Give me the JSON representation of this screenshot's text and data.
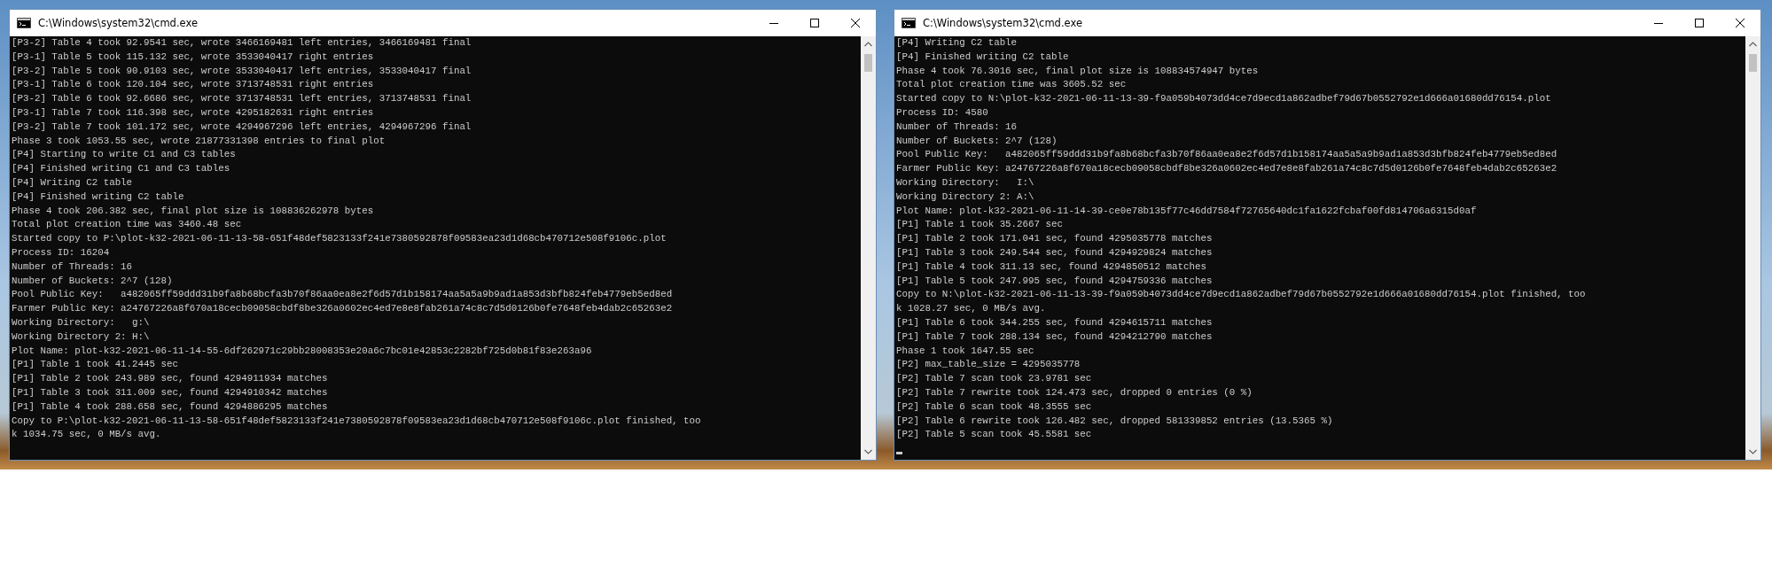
{
  "windows": [
    {
      "title": "C:\\Windows\\system32\\cmd.exe",
      "cursor": false,
      "lines": [
        "[P3-2] Table 4 took 92.9541 sec, wrote 3466169481 left entries, 3466169481 final",
        "[P3-1] Table 5 took 115.132 sec, wrote 3533040417 right entries",
        "[P3-2] Table 5 took 90.9103 sec, wrote 3533040417 left entries, 3533040417 final",
        "[P3-1] Table 6 took 120.104 sec, wrote 3713748531 right entries",
        "[P3-2] Table 6 took 92.6686 sec, wrote 3713748531 left entries, 3713748531 final",
        "[P3-1] Table 7 took 116.398 sec, wrote 4295182631 right entries",
        "[P3-2] Table 7 took 101.172 sec, wrote 4294967296 left entries, 4294967296 final",
        "Phase 3 took 1053.55 sec, wrote 21877331398 entries to final plot",
        "[P4] Starting to write C1 and C3 tables",
        "[P4] Finished writing C1 and C3 tables",
        "[P4] Writing C2 table",
        "[P4] Finished writing C2 table",
        "Phase 4 took 206.382 sec, final plot size is 108836262978 bytes",
        "Total plot creation time was 3460.48 sec",
        "Started copy to P:\\plot-k32-2021-06-11-13-58-651f48def5823133f241e7380592878f09583ea23d1d68cb470712e508f9106c.plot",
        "Process ID: 16204",
        "Number of Threads: 16",
        "Number of Buckets: 2^7 (128)",
        "Pool Public Key:   a482065ff59ddd31b9fa8b68bcfa3b70f86aa0ea8e2f6d57d1b158174aa5a5a9b9ad1a853d3bfb824feb4779eb5ed8ed",
        "Farmer Public Key: a24767226a8f670a18cecb09058cbdf8be326a0602ec4ed7e8e8fab261a74c8c7d5d0126b0fe7648feb4dab2c65263e2",
        "Working Directory:   g:\\",
        "Working Directory 2: H:\\",
        "Plot Name: plot-k32-2021-06-11-14-55-6df262971c29bb28008353e20a6c7bc01e42853c2282bf725d0b81f83e263a96",
        "[P1] Table 1 took 41.2445 sec",
        "[P1] Table 2 took 243.989 sec, found 4294911934 matches",
        "[P1] Table 3 took 311.009 sec, found 4294910342 matches",
        "[P1] Table 4 took 288.658 sec, found 4294886295 matches",
        "Copy to P:\\plot-k32-2021-06-11-13-58-651f48def5823133f241e7380592878f09583ea23d1d68cb470712e508f9106c.plot finished, too",
        "k 1034.75 sec, 0 MB/s avg."
      ]
    },
    {
      "title": "C:\\Windows\\system32\\cmd.exe",
      "cursor": true,
      "lines": [
        "[P4] Writing C2 table",
        "[P4] Finished writing C2 table",
        "Phase 4 took 76.3016 sec, final plot size is 108834574947 bytes",
        "Total plot creation time was 3605.52 sec",
        "Started copy to N:\\plot-k32-2021-06-11-13-39-f9a059b4073dd4ce7d9ecd1a862adbef79d67b0552792e1d666a01680dd76154.plot",
        "Process ID: 4580",
        "Number of Threads: 16",
        "Number of Buckets: 2^7 (128)",
        "Pool Public Key:   a482065ff59ddd31b9fa8b68bcfa3b70f86aa0ea8e2f6d57d1b158174aa5a5a9b9ad1a853d3bfb824feb4779eb5ed8ed",
        "Farmer Public Key: a24767226a8f670a18cecb09058cbdf8be326a0602ec4ed7e8e8fab261a74c8c7d5d0126b0fe7648feb4dab2c65263e2",
        "Working Directory:   I:\\",
        "Working Directory 2: A:\\",
        "Plot Name: plot-k32-2021-06-11-14-39-ce0e78b135f77c46dd7584f72765640dc1fa1622fcbaf00fd814706a6315d0af",
        "[P1] Table 1 took 35.2667 sec",
        "[P1] Table 2 took 171.041 sec, found 4295035778 matches",
        "[P1] Table 3 took 249.544 sec, found 4294929824 matches",
        "[P1] Table 4 took 311.13 sec, found 4294850512 matches",
        "[P1] Table 5 took 247.995 sec, found 4294759336 matches",
        "Copy to N:\\plot-k32-2021-06-11-13-39-f9a059b4073dd4ce7d9ecd1a862adbef79d67b0552792e1d666a01680dd76154.plot finished, too",
        "k 1028.27 sec, 0 MB/s avg.",
        "[P1] Table 6 took 344.255 sec, found 4294615711 matches",
        "[P1] Table 7 took 288.134 sec, found 4294212790 matches",
        "Phase 1 took 1647.55 sec",
        "[P2] max_table_size = 4295035778",
        "[P2] Table 7 scan took 23.9781 sec",
        "[P2] Table 7 rewrite took 124.473 sec, dropped 0 entries (0 %)",
        "[P2] Table 6 scan took 48.3555 sec",
        "[P2] Table 6 rewrite took 126.482 sec, dropped 581339852 entries (13.5365 %)",
        "[P2] Table 5 scan took 45.5581 sec"
      ]
    }
  ]
}
